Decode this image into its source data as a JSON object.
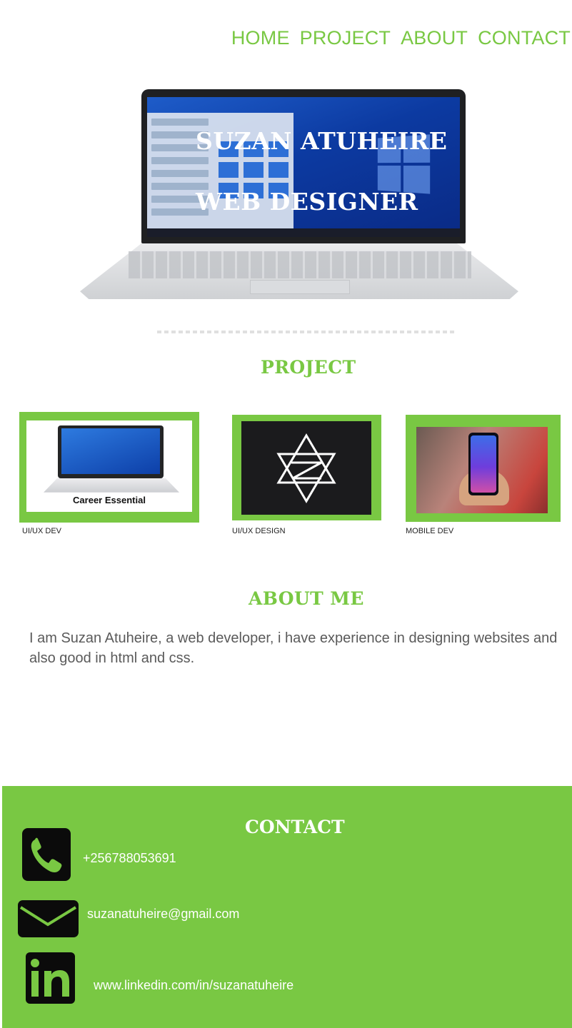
{
  "nav": {
    "items": [
      "HOME",
      "PROJECT",
      "ABOUT",
      "CONTACT"
    ]
  },
  "hero": {
    "name": "SUZAN  ATUHEIRE",
    "role": "WEB DESIGNER"
  },
  "projects": {
    "title": "PROJECT",
    "cards": [
      {
        "label": "UI/UX DEV",
        "image_caption": "Career Essential"
      },
      {
        "label": "UI/UX DESIGN"
      },
      {
        "label": "MOBILE DEV"
      }
    ]
  },
  "about": {
    "title": "ABOUT ME",
    "text": "I am  Suzan  Atuheire, a web developer, i have experience in designing websites and also good in html  and css."
  },
  "contact": {
    "title": "CONTACT",
    "phone": "+256788053691",
    "email": "suzanatuheire@gmail.com",
    "linkedin": "www.linkedin.com/in/suzanatuheire"
  },
  "colors": {
    "accent": "#79c843",
    "icon_bg": "#0b0b0b"
  }
}
